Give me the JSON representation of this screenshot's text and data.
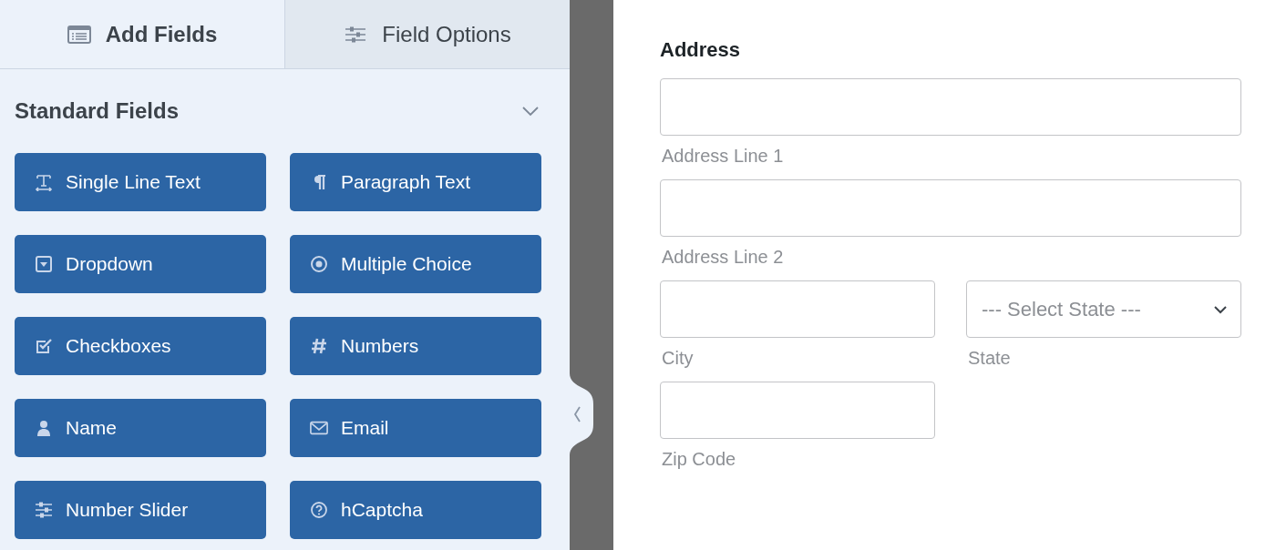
{
  "tabs": [
    {
      "label": "Add Fields",
      "kind": "list",
      "selected": true
    },
    {
      "label": "Field Options",
      "kind": "sliders",
      "selected": false
    }
  ],
  "section": {
    "title": "Standard Fields",
    "expanded": true
  },
  "fields": [
    {
      "label": "Single Line Text",
      "kind": "text"
    },
    {
      "label": "Paragraph Text",
      "kind": "paragraph"
    },
    {
      "label": "Dropdown",
      "kind": "dropdown"
    },
    {
      "label": "Multiple Choice",
      "kind": "radio"
    },
    {
      "label": "Checkboxes",
      "kind": "checkbox"
    },
    {
      "label": "Numbers",
      "kind": "number"
    },
    {
      "label": "Name",
      "kind": "person"
    },
    {
      "label": "Email",
      "kind": "email"
    },
    {
      "label": "Number Slider",
      "kind": "slider"
    },
    {
      "label": "hCaptcha",
      "kind": "captcha"
    }
  ],
  "form": {
    "label": "Address",
    "rows": [
      {
        "kind": "full",
        "cells": [
          {
            "kind": "input",
            "sublabel": "Address Line 1"
          }
        ]
      },
      {
        "kind": "full",
        "cells": [
          {
            "kind": "input",
            "sublabel": "Address Line 2"
          }
        ]
      },
      {
        "kind": "split",
        "cells": [
          {
            "kind": "input",
            "sublabel": "City"
          },
          {
            "kind": "select",
            "value": "--- Select State ---",
            "sublabel": "State"
          }
        ]
      },
      {
        "kind": "split",
        "cells": [
          {
            "kind": "input",
            "sublabel": "Zip Code"
          }
        ]
      }
    ]
  }
}
